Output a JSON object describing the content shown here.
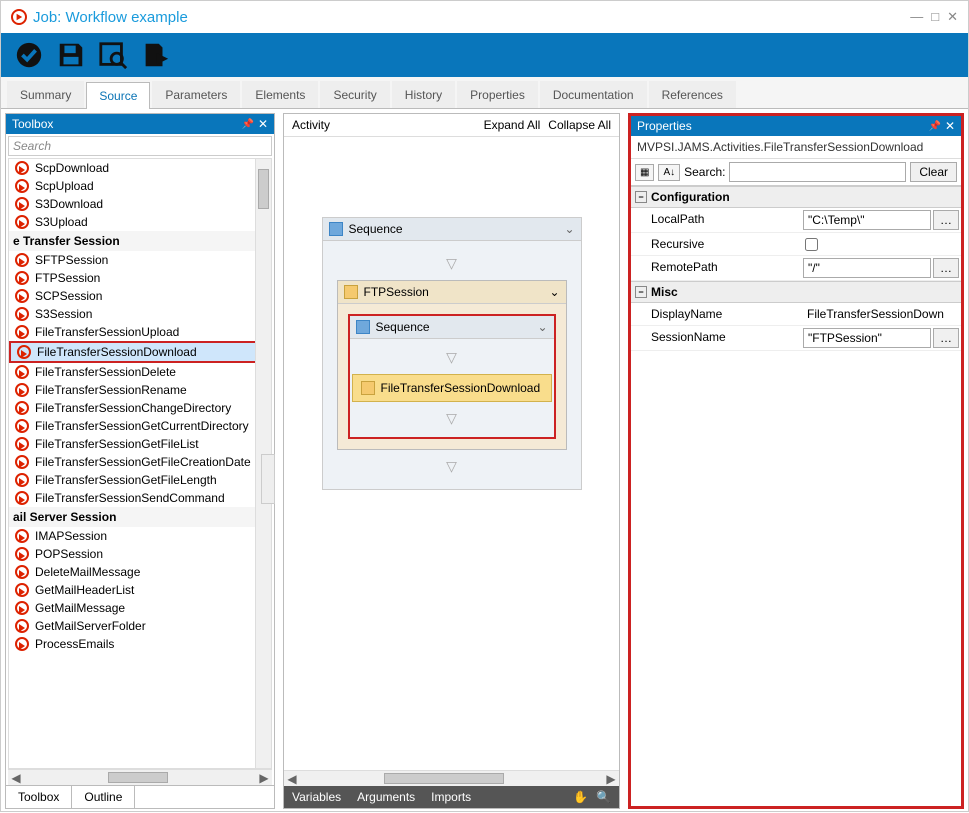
{
  "window": {
    "title": "Job: Workflow example"
  },
  "tabs": [
    "Summary",
    "Source",
    "Parameters",
    "Elements",
    "Security",
    "History",
    "Properties",
    "Documentation",
    "References"
  ],
  "activeTab": "Source",
  "toolbox": {
    "title": "Toolbox",
    "searchPlaceholder": "Search",
    "items": [
      {
        "type": "item",
        "label": "ScpDownload"
      },
      {
        "type": "item",
        "label": "ScpUpload"
      },
      {
        "type": "item",
        "label": "S3Download"
      },
      {
        "type": "item",
        "label": "S3Upload"
      },
      {
        "type": "cat",
        "label": "e Transfer Session"
      },
      {
        "type": "item",
        "label": "SFTPSession"
      },
      {
        "type": "item",
        "label": "FTPSession"
      },
      {
        "type": "item",
        "label": "SCPSession"
      },
      {
        "type": "item",
        "label": "S3Session"
      },
      {
        "type": "item",
        "label": "FileTransferSessionUpload"
      },
      {
        "type": "item",
        "label": "FileTransferSessionDownload",
        "selected": true
      },
      {
        "type": "item",
        "label": "FileTransferSessionDelete"
      },
      {
        "type": "item",
        "label": "FileTransferSessionRename"
      },
      {
        "type": "item",
        "label": "FileTransferSessionChangeDirectory"
      },
      {
        "type": "item",
        "label": "FileTransferSessionGetCurrentDirectory"
      },
      {
        "type": "item",
        "label": "FileTransferSessionGetFileList"
      },
      {
        "type": "item",
        "label": "FileTransferSessionGetFileCreationDate"
      },
      {
        "type": "item",
        "label": "FileTransferSessionGetFileLength"
      },
      {
        "type": "item",
        "label": "FileTransferSessionSendCommand"
      },
      {
        "type": "cat",
        "label": "ail Server Session"
      },
      {
        "type": "item",
        "label": "IMAPSession"
      },
      {
        "type": "item",
        "label": "POPSession"
      },
      {
        "type": "item",
        "label": "DeleteMailMessage"
      },
      {
        "type": "item",
        "label": "GetMailHeaderList"
      },
      {
        "type": "item",
        "label": "GetMailMessage"
      },
      {
        "type": "item",
        "label": "GetMailServerFolder"
      },
      {
        "type": "item",
        "label": "ProcessEmails"
      }
    ],
    "bottomTabs": [
      "Toolbox",
      "Outline"
    ]
  },
  "designer": {
    "activityLabel": "Activity",
    "expandAll": "Expand All",
    "collapseAll": "Collapse All",
    "outerSeq": "Sequence",
    "ftpSession": "FTPSession",
    "innerSeq": "Sequence",
    "activityNode": "FileTransferSessionDownload",
    "bottomBar": [
      "Variables",
      "Arguments",
      "Imports"
    ]
  },
  "properties": {
    "title": "Properties",
    "typeName": "MVPSI.JAMS.Activities.FileTransferSessionDownload",
    "searchLabel": "Search:",
    "clearLabel": "Clear",
    "groups": [
      {
        "name": "Configuration",
        "rows": [
          {
            "name": "LocalPath",
            "value": "\"C:\\Temp\\\"",
            "kind": "textbtn"
          },
          {
            "name": "Recursive",
            "value": "",
            "kind": "check"
          },
          {
            "name": "RemotePath",
            "value": "\"/\"",
            "kind": "textbtn"
          }
        ]
      },
      {
        "name": "Misc",
        "rows": [
          {
            "name": "DisplayName",
            "value": "FileTransferSessionDown",
            "kind": "plain"
          },
          {
            "name": "SessionName",
            "value": "\"FTPSession\"",
            "kind": "textbtn"
          }
        ]
      }
    ]
  }
}
